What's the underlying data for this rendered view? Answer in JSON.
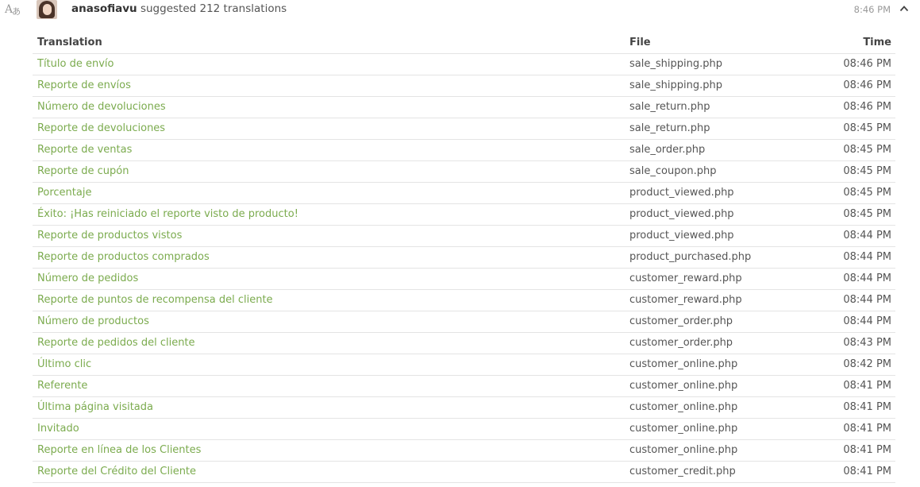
{
  "header": {
    "icon": "translate-icon",
    "username": "anasofiavu",
    "action_text": " suggested 212 translations",
    "time": "8:46 PM",
    "collapse_icon": "chevron-up-icon"
  },
  "table": {
    "columns": {
      "translation": "Translation",
      "file": "File",
      "time": "Time"
    },
    "rows": [
      {
        "translation": "Título de envío",
        "file": "sale_shipping.php",
        "time": "08:46 PM"
      },
      {
        "translation": "Reporte de envíos",
        "file": "sale_shipping.php",
        "time": "08:46 PM"
      },
      {
        "translation": "Número de devoluciones",
        "file": "sale_return.php",
        "time": "08:46 PM"
      },
      {
        "translation": "Reporte de devoluciones",
        "file": "sale_return.php",
        "time": "08:45 PM"
      },
      {
        "translation": "Reporte de ventas",
        "file": "sale_order.php",
        "time": "08:45 PM"
      },
      {
        "translation": "Reporte de cupón",
        "file": "sale_coupon.php",
        "time": "08:45 PM"
      },
      {
        "translation": "Porcentaje",
        "file": "product_viewed.php",
        "time": "08:45 PM"
      },
      {
        "translation": "Éxito: ¡Has reiniciado el reporte visto de producto!",
        "file": "product_viewed.php",
        "time": "08:45 PM"
      },
      {
        "translation": "Reporte de productos vistos",
        "file": "product_viewed.php",
        "time": "08:44 PM"
      },
      {
        "translation": "Reporte de productos comprados",
        "file": "product_purchased.php",
        "time": "08:44 PM"
      },
      {
        "translation": "Número de pedidos",
        "file": "customer_reward.php",
        "time": "08:44 PM"
      },
      {
        "translation": "Reporte de puntos de recompensa del cliente",
        "file": "customer_reward.php",
        "time": "08:44 PM"
      },
      {
        "translation": "Número de productos",
        "file": "customer_order.php",
        "time": "08:44 PM"
      },
      {
        "translation": "Reporte de pedidos del cliente",
        "file": "customer_order.php",
        "time": "08:43 PM"
      },
      {
        "translation": "Último clic",
        "file": "customer_online.php",
        "time": "08:42 PM"
      },
      {
        "translation": "Referente",
        "file": "customer_online.php",
        "time": "08:41 PM"
      },
      {
        "translation": "Última página visitada",
        "file": "customer_online.php",
        "time": "08:41 PM"
      },
      {
        "translation": "Invitado",
        "file": "customer_online.php",
        "time": "08:41 PM"
      },
      {
        "translation": "Reporte en línea de los Clientes",
        "file": "customer_online.php",
        "time": "08:41 PM"
      },
      {
        "translation": "Reporte del Crédito del Cliente",
        "file": "customer_credit.php",
        "time": "08:41 PM"
      }
    ]
  },
  "colors": {
    "translation_link": "#7bab4e",
    "border": "#e4e4e4",
    "muted": "#999999"
  }
}
